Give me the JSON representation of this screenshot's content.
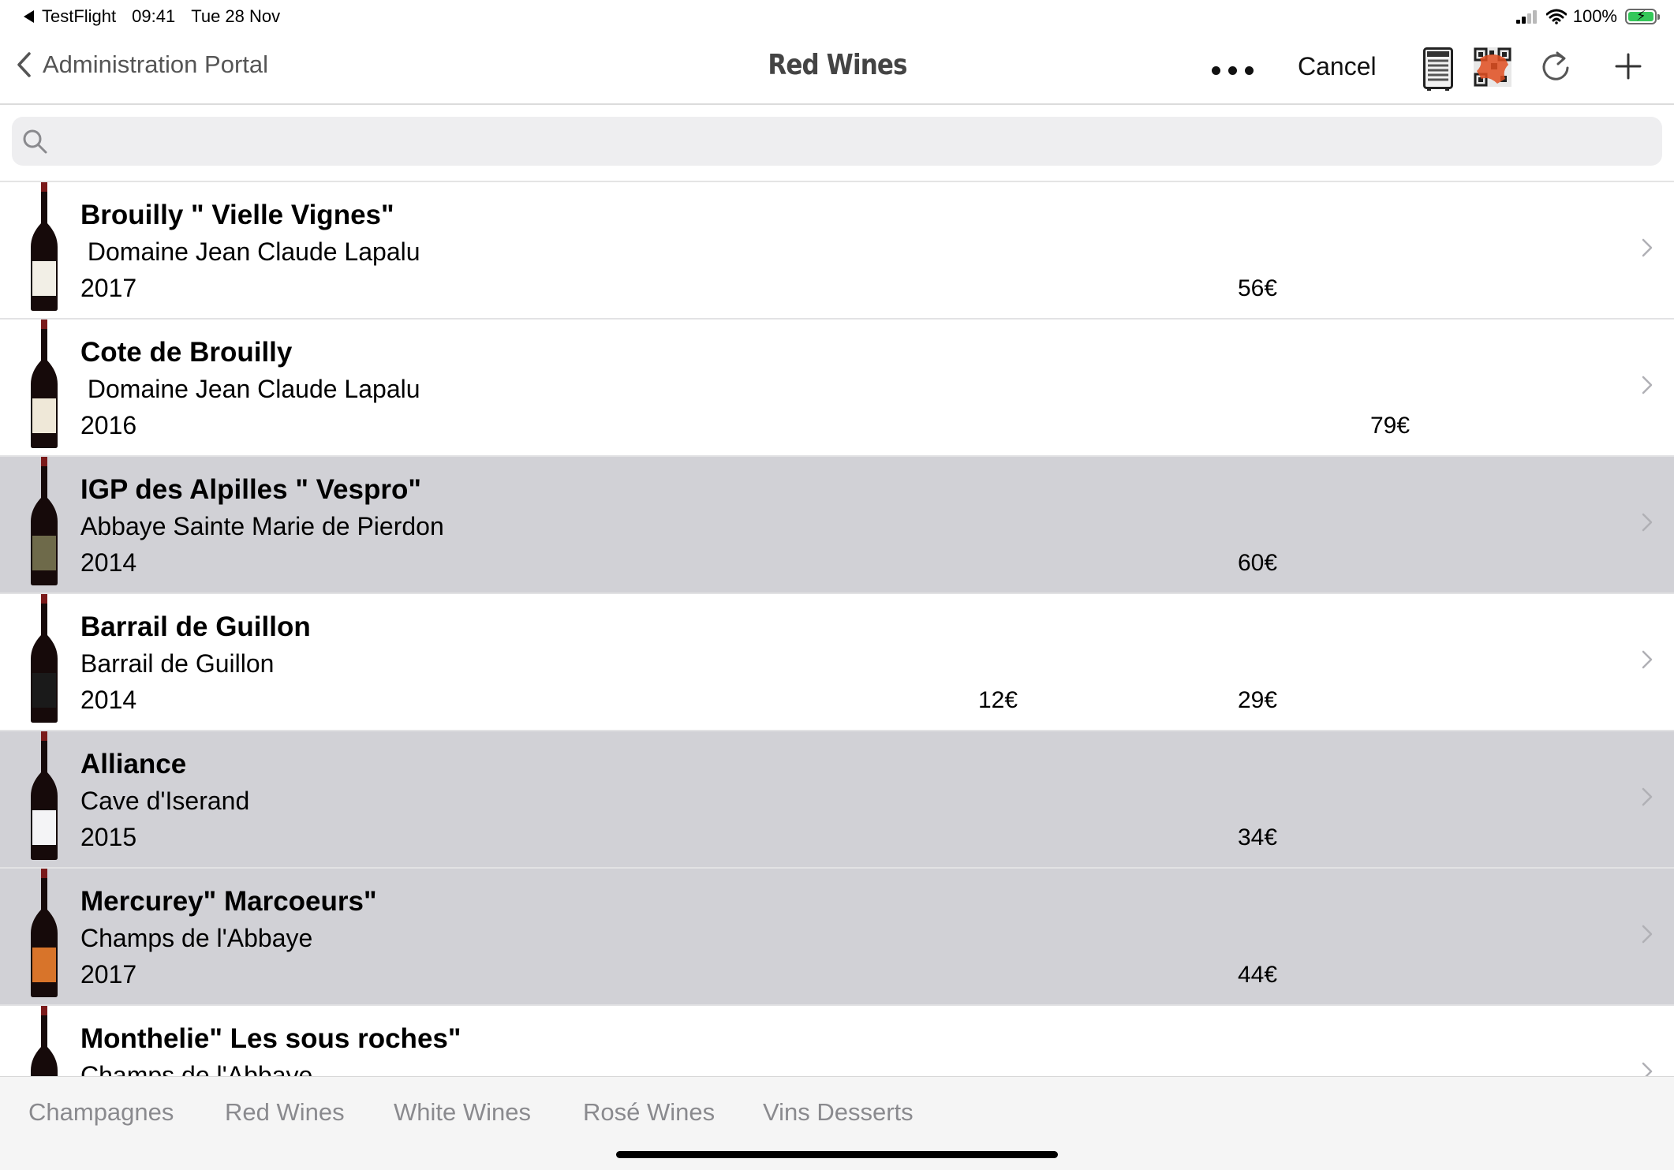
{
  "status": {
    "app": "TestFlight",
    "time": "09:41",
    "date": "Tue 28 Nov",
    "battery": "100%",
    "battery_level": 1.0
  },
  "nav": {
    "back_label": "Administration Portal",
    "title": "Red Wines",
    "cancel_label": "Cancel"
  },
  "search": {
    "placeholder": "",
    "value": ""
  },
  "wines": [
    {
      "name": "Brouilly \" Vielle Vignes\"",
      "producer": " Domaine Jean Claude Lapalu",
      "year": "2017",
      "price_a": "",
      "price_b": "56€",
      "price_c": "",
      "selected": false,
      "label_color": "#f2efe6"
    },
    {
      "name": "Cote de Brouilly",
      "producer": " Domaine Jean Claude Lapalu",
      "year": "2016",
      "price_a": "",
      "price_b": "",
      "price_c": "79€",
      "selected": false,
      "label_color": "#efe8d8"
    },
    {
      "name": "IGP des Alpilles \" Vespro\"",
      "producer": "Abbaye Sainte Marie de Pierdon",
      "year": "2014",
      "price_a": "",
      "price_b": "60€",
      "price_c": "",
      "selected": true,
      "label_color": "#6e6a4a"
    },
    {
      "name": "Barrail de Guillon",
      "producer": "Barrail de Guillon",
      "year": "2014",
      "price_a": "12€",
      "price_b": "29€",
      "price_c": "",
      "selected": false,
      "label_color": "#1a1a1a"
    },
    {
      "name": "Alliance",
      "producer": "Cave d'Iserand",
      "year": "2015",
      "price_a": "",
      "price_b": "34€",
      "price_c": "",
      "selected": true,
      "label_color": "#f4f4f6"
    },
    {
      "name": "Mercurey\" Marcoeurs\"",
      "producer": "Champs de l'Abbaye",
      "year": "2017",
      "price_a": "",
      "price_b": "44€",
      "price_c": "",
      "selected": true,
      "label_color": "#d8742a"
    },
    {
      "name": "Monthelie\" Les sous roches\"",
      "producer": "Champs de l'Abbaye",
      "year": "",
      "price_a": "",
      "price_b": "",
      "price_c": "",
      "selected": false,
      "label_color": "#c8a060"
    }
  ],
  "tabs": [
    "Champagnes",
    "Red Wines",
    "White Wines",
    "Rosé Wines",
    "Vins Desserts"
  ],
  "colors": {
    "selected_row": "#d1d1d6",
    "tab_text": "#8a8a8e",
    "battery_green": "#34c759"
  }
}
